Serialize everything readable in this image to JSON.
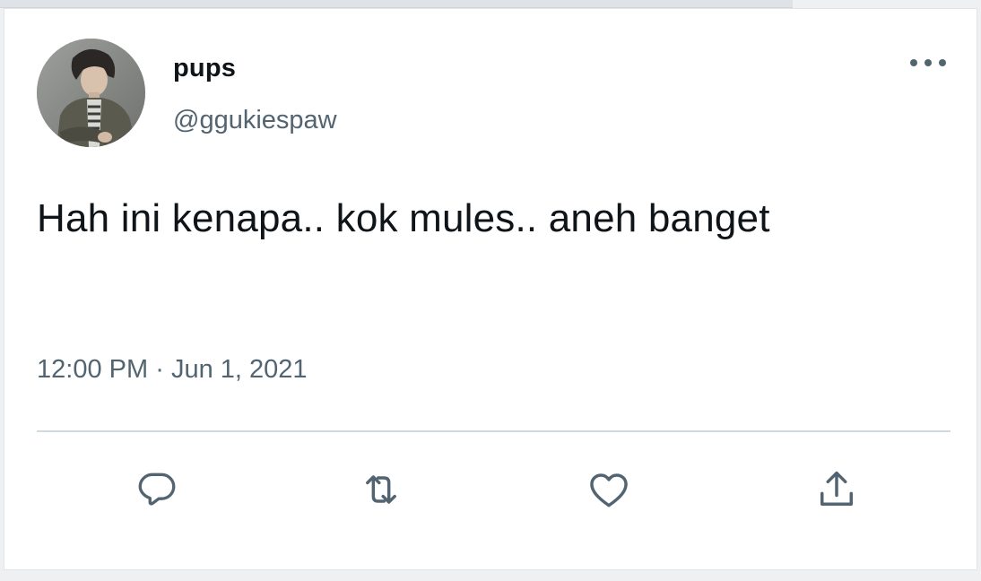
{
  "tweet": {
    "author": {
      "display_name": "pups",
      "handle": "@ggukiespaw",
      "avatar_icon": "profile-photo"
    },
    "text": "Hah ini kenapa.. kok mules.. aneh banget",
    "time": "12:00 PM",
    "separator": "·",
    "date": "Jun 1, 2021"
  },
  "actions": [
    {
      "name": "reply",
      "icon": "reply-icon"
    },
    {
      "name": "retweet",
      "icon": "retweet-icon"
    },
    {
      "name": "like",
      "icon": "heart-icon"
    },
    {
      "name": "share",
      "icon": "share-icon"
    }
  ],
  "colors": {
    "text_primary": "#0f1419",
    "text_secondary": "#536471",
    "divider": "#cfd9de",
    "card_bg": "#ffffff"
  }
}
